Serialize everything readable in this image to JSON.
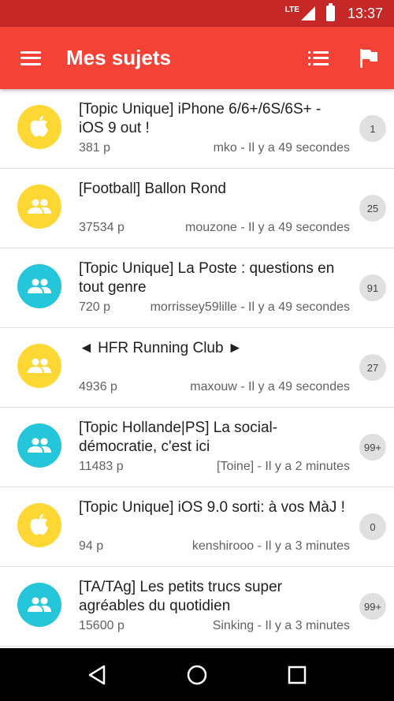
{
  "status_bar": {
    "network": "LTE",
    "time": "13:37"
  },
  "app_bar": {
    "title": "Mes sujets",
    "menu_icon": "hamburger-menu-icon",
    "list_icon": "list-icon",
    "flag_icon": "flag-icon"
  },
  "colors": {
    "status_bar": "#c62828",
    "app_bar": "#f44336",
    "avatar_yellow": "#fdd835",
    "avatar_cyan": "#26c6da",
    "count_badge": "#e0e0e0"
  },
  "topics": [
    {
      "title": " [Topic Unique] iPhone 6/6+/6S/6S+ - iOS 9 out !",
      "pages": "381 p",
      "meta": "mko - Il y a 49 secondes",
      "count": "1",
      "icon": "apple-icon",
      "color": "yellow"
    },
    {
      "title": "[Football] Ballon Rond",
      "pages": "37534 p",
      "meta": "mouzone - Il y a 49 secondes",
      "count": "25",
      "icon": "group-icon",
      "color": "yellow"
    },
    {
      "title": "[Topic Unique] La Poste : questions en tout genre",
      "pages": "720 p",
      "meta": "morrissey59lille - Il y a 49 secondes",
      "count": "91",
      "icon": "group-icon",
      "color": "cyan"
    },
    {
      "title": "◄ HFR Running Club ►",
      "pages": "4936 p",
      "meta": "maxouw - Il y a 49 secondes",
      "count": "27",
      "icon": "group-icon",
      "color": "yellow"
    },
    {
      "title": "[Topic Hollande|PS] La social-démocratie, c'est ici",
      "pages": "11483 p",
      "meta": "[Toine] - Il y a 2 minutes",
      "count": "99+",
      "icon": "group-icon",
      "color": "cyan"
    },
    {
      "title": "[Topic Unique] iOS 9.0 sorti: à vos MàJ !",
      "pages": "94 p",
      "meta": "kenshirooo - Il y a 3 minutes",
      "count": "0",
      "icon": "apple-icon",
      "color": "yellow"
    },
    {
      "title": "[TA/TAg] Les petits trucs super agréables du quotidien",
      "pages": "15600 p",
      "meta": "Sinking - Il y a 3 minutes",
      "count": "99+",
      "icon": "group-icon",
      "color": "cyan"
    }
  ],
  "nav_bar": {
    "back_icon": "back-triangle-icon",
    "home_icon": "home-circle-icon",
    "recents_icon": "recents-square-icon"
  }
}
